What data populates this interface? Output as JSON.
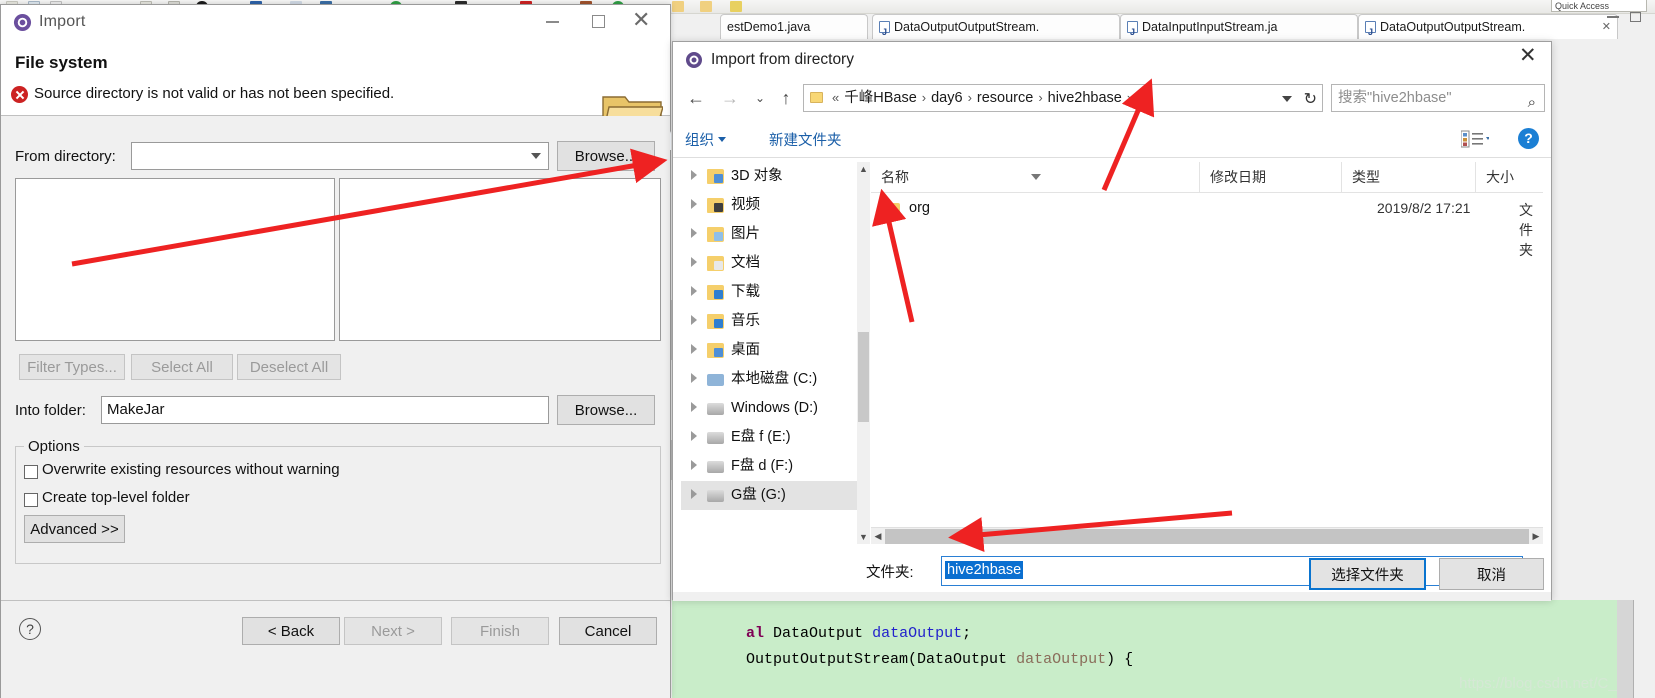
{
  "eclipse": {
    "quick_access": "Quick Access",
    "tabs": [
      {
        "label": "estDemo1.java",
        "has_icon": false,
        "closable": false
      },
      {
        "label": "DataOutputOutputStream.",
        "has_icon": true,
        "closable": false
      },
      {
        "label": "DataInputInputStream.ja",
        "has_icon": true,
        "closable": false
      },
      {
        "label": "DataOutputOutputStream.",
        "has_icon": true,
        "closable": true
      }
    ],
    "code_lines": [
      {
        "parts": [
          {
            "t": "al ",
            "c": "kw"
          },
          {
            "t": "DataOutput ",
            "c": ""
          },
          {
            "t": "dataOutput",
            "c": "id"
          },
          {
            "t": ";",
            "c": ""
          }
        ]
      },
      {
        "parts": [
          {
            "t": "OutputOutputStream(DataOutput ",
            "c": ""
          },
          {
            "t": "dataOutput",
            "c": "pr"
          },
          {
            "t": ") {",
            "c": ""
          }
        ]
      }
    ],
    "watermark": "https://blog.csdn.net/C_time"
  },
  "import_dialog": {
    "title": "Import",
    "icon": "eclipse-wizard-icon",
    "page_title": "File system",
    "error_message": "Source directory is not valid or has not been specified.",
    "from_directory_label": "From directory:",
    "from_directory_value": "",
    "browse_label": "Browse...",
    "filter_types_label": "Filter Types...",
    "select_all_label": "Select All",
    "deselect_all_label": "Deselect All",
    "into_folder_label": "Into folder:",
    "into_folder_value": "MakeJar",
    "into_browse_label": "Browse...",
    "options_group_label": "Options",
    "option_overwrite": "Overwrite existing resources without warning",
    "option_create_top": "Create top-level folder",
    "advanced_label": "Advanced >>",
    "help_glyph": "?",
    "buttons": {
      "back": "< Back",
      "next": "Next >",
      "finish": "Finish",
      "cancel": "Cancel"
    },
    "window_controls": {
      "minimize": "minimize-icon",
      "maximize": "maximize-icon",
      "close": "close-icon"
    }
  },
  "file_dialog": {
    "title": "Import from directory",
    "breadcrumb": [
      "千峰HBase",
      "day6",
      "resource",
      "hive2hbase"
    ],
    "breadcrumb_prefix": "«",
    "search_placeholder": "搜索\"hive2hbase\"",
    "organize_label": "组织",
    "new_folder_label": "新建文件夹",
    "tree_items": [
      {
        "label": "3D 对象",
        "icon": "folder-3d-icon",
        "selected": false
      },
      {
        "label": "视频",
        "icon": "folder-video-icon",
        "selected": false
      },
      {
        "label": "图片",
        "icon": "folder-pictures-icon",
        "selected": false
      },
      {
        "label": "文档",
        "icon": "folder-documents-icon",
        "selected": false
      },
      {
        "label": "下载",
        "icon": "folder-downloads-icon",
        "selected": false
      },
      {
        "label": "音乐",
        "icon": "folder-music-icon",
        "selected": false
      },
      {
        "label": "桌面",
        "icon": "folder-desktop-icon",
        "selected": false
      },
      {
        "label": "本地磁盘 (C:)",
        "icon": "disk-windows-icon",
        "selected": false
      },
      {
        "label": "Windows (D:)",
        "icon": "disk-icon",
        "selected": false
      },
      {
        "label": "E盘 f (E:)",
        "icon": "disk-icon",
        "selected": false
      },
      {
        "label": "F盘 d (F:)",
        "icon": "disk-icon",
        "selected": false
      },
      {
        "label": "G盘 (G:)",
        "icon": "disk-icon",
        "selected": true
      }
    ],
    "columns": [
      "名称",
      "修改日期",
      "类型",
      "大小"
    ],
    "rows": [
      {
        "name": "org",
        "date": "2019/8/2 17:21",
        "type": "文件夹",
        "size": ""
      }
    ],
    "folder_field_label": "文件夹:",
    "folder_field_value": "hive2hbase",
    "select_button": "选择文件夹",
    "cancel_button": "取消",
    "help_glyph": "?",
    "close_glyph": "✕"
  },
  "colors": {
    "accent_blue": "#0a74cf",
    "selection_blue": "#0a6fd0",
    "error_red": "#cc2222",
    "annotation_red": "#ee2222",
    "code_bg": "#c9edc9",
    "folder_yellow": "#f5cf6b"
  }
}
